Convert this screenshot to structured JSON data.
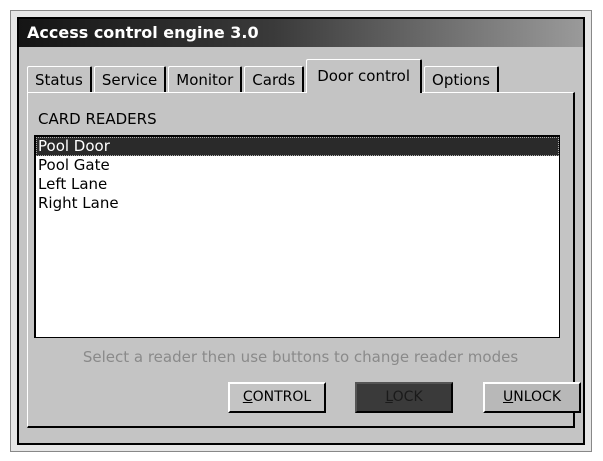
{
  "window": {
    "title": "Access control engine 3.0"
  },
  "tabs": [
    {
      "label": "Status"
    },
    {
      "label": "Service"
    },
    {
      "label": "Monitor"
    },
    {
      "label": "Cards"
    },
    {
      "label": "Door control",
      "active": true
    },
    {
      "label": "Options"
    }
  ],
  "section": {
    "label": "CARD READERS"
  },
  "readers": [
    {
      "label": "Pool Door",
      "selected": true
    },
    {
      "label": "Pool Gate"
    },
    {
      "label": "Left Lane"
    },
    {
      "label": "Right Lane"
    }
  ],
  "hint": "Select a reader then use buttons to change reader modes",
  "buttons": {
    "control": {
      "mnemonic": "C",
      "rest": "ONTROL"
    },
    "lock": {
      "mnemonic": "L",
      "rest": "OCK"
    },
    "unlock": {
      "mnemonic": "U",
      "rest": "NLOCK"
    }
  }
}
